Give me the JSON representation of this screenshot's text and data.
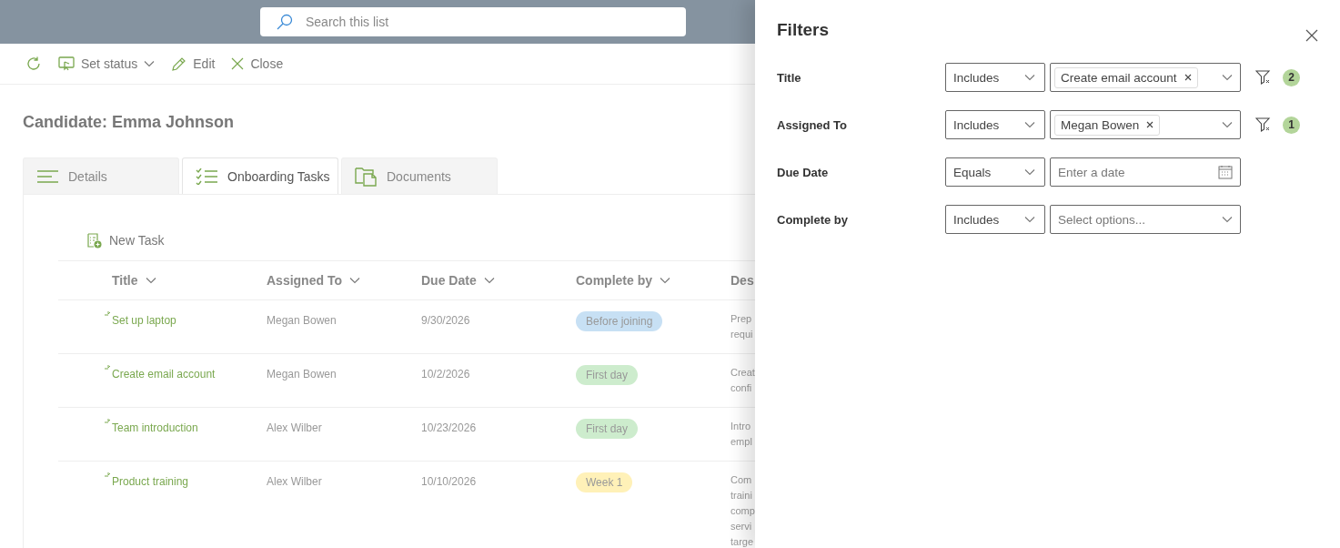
{
  "search": {
    "placeholder": "Search this list"
  },
  "toolbar": [
    {
      "kind": "refresh"
    },
    {
      "kind": "status",
      "label": "Set status"
    },
    {
      "kind": "edit",
      "label": "Edit"
    },
    {
      "kind": "close",
      "label": "Close"
    }
  ],
  "page_title": "Candidate: Emma Johnson",
  "tabs": [
    {
      "kind": "details",
      "label": "Details",
      "selected": false
    },
    {
      "kind": "tasks",
      "label": "Onboarding Tasks",
      "selected": true
    },
    {
      "kind": "documents",
      "label": "Documents",
      "selected": false
    }
  ],
  "new_task": "New Task",
  "table": {
    "columns": [
      "Title",
      "Assigned To",
      "Due Date",
      "Complete by",
      "Des"
    ],
    "rows": [
      {
        "is_new": true,
        "title": "Set up laptop",
        "assigned_to": "Megan Bowen",
        "due_date": "9/30/2026",
        "complete_by": {
          "label": "Before joining",
          "color": "#c7e0f4"
        },
        "description": [
          "Prep",
          "requi"
        ]
      },
      {
        "is_new": true,
        "title": "Create email account",
        "assigned_to": "Megan Bowen",
        "due_date": "10/2/2026",
        "complete_by": {
          "label": "First day",
          "color": "#cdeccd"
        },
        "description": [
          "Creat",
          "confi"
        ]
      },
      {
        "is_new": true,
        "title": "Team introduction",
        "assigned_to": "Alex Wilber",
        "due_date": "10/23/2026",
        "complete_by": {
          "label": "First day",
          "color": "#cdeccd"
        },
        "description": [
          "Intro",
          "empl"
        ]
      },
      {
        "is_new": true,
        "title": "Product training",
        "assigned_to": "Alex Wilber",
        "due_date": "10/10/2026",
        "complete_by": {
          "label": "Week 1",
          "color": "#fff1b8"
        },
        "description": [
          "Com",
          "traini",
          "comp",
          "servi",
          "targe"
        ]
      }
    ]
  },
  "filters": {
    "title": "Filters",
    "rows": [
      {
        "label": "Title",
        "operator": "Includes",
        "kind": "tags",
        "tags": [
          "Create email account"
        ],
        "count": "2"
      },
      {
        "label": "Assigned To",
        "operator": "Includes",
        "kind": "tags",
        "tags": [
          "Megan Bowen"
        ],
        "count": "1"
      },
      {
        "label": "Due Date",
        "operator": "Equals",
        "kind": "date",
        "placeholder": "Enter a date"
      },
      {
        "label": "Complete by",
        "operator": "Includes",
        "kind": "select",
        "placeholder": "Select options..."
      }
    ]
  }
}
